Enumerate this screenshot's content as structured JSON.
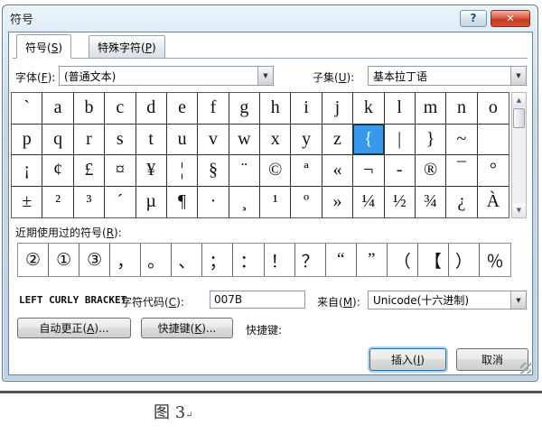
{
  "window": {
    "title": "符号",
    "help_label": "?",
    "close_label": "✕"
  },
  "tabs": {
    "symbols": "符号(S)",
    "special_chars": "特殊字符(P)"
  },
  "font_row": {
    "font_label": "字体(F):",
    "font_value": "(普通文本)",
    "subset_label": "子集(U):",
    "subset_value": "基本拉丁语"
  },
  "grid": {
    "rows": [
      [
        "`",
        "a",
        "b",
        "c",
        "d",
        "e",
        "f",
        "g",
        "h",
        "i",
        "j",
        "k",
        "l",
        "m",
        "n",
        "o"
      ],
      [
        "p",
        "q",
        "r",
        "s",
        "t",
        "u",
        "v",
        "w",
        "x",
        "y",
        "z",
        "{",
        "|",
        "}",
        "~",
        ""
      ],
      [
        "¡",
        "¢",
        "£",
        "¤",
        "¥",
        "¦",
        "§",
        "¨",
        "©",
        "ª",
        "«",
        "¬",
        "-",
        "®",
        "¯",
        "°"
      ],
      [
        "±",
        "²",
        "³",
        "´",
        "µ",
        "¶",
        "·",
        "¸",
        "¹",
        "º",
        "»",
        "¼",
        "½",
        "¾",
        "¿",
        "À"
      ]
    ],
    "selected": {
      "row": 1,
      "col": 11,
      "symbol": "{"
    }
  },
  "scrollbar": {
    "up_glyph": "▲",
    "down_glyph": "▼"
  },
  "recent": {
    "label": "近期使用过的符号(R):",
    "symbols": [
      "②",
      "①",
      "③",
      "，",
      "。",
      "、",
      "；",
      "：",
      "！",
      "？",
      "“",
      "”",
      "（",
      "【",
      "）",
      "％"
    ]
  },
  "detail": {
    "symbol_name": "LEFT CURLY BRACKET",
    "char_code_label": "字符代码(C):",
    "char_code_value": "007B",
    "from_label": "来自(M):",
    "from_value": "Unicode(十六进制)"
  },
  "actions": {
    "autocorrect": "自动更正(A)...",
    "shortcut_button": "快捷键(K)...",
    "shortcut_label": "快捷键:",
    "insert": "插入(I)",
    "cancel": "取消"
  },
  "caption": {
    "text": "图 3",
    "mark": "↵"
  },
  "colors": {
    "selection_blue": "#3898e9",
    "titlebar_blue": "#c6d9e9",
    "close_red": "#c43c22",
    "insert_focus_ring": "#a9d4ee"
  }
}
